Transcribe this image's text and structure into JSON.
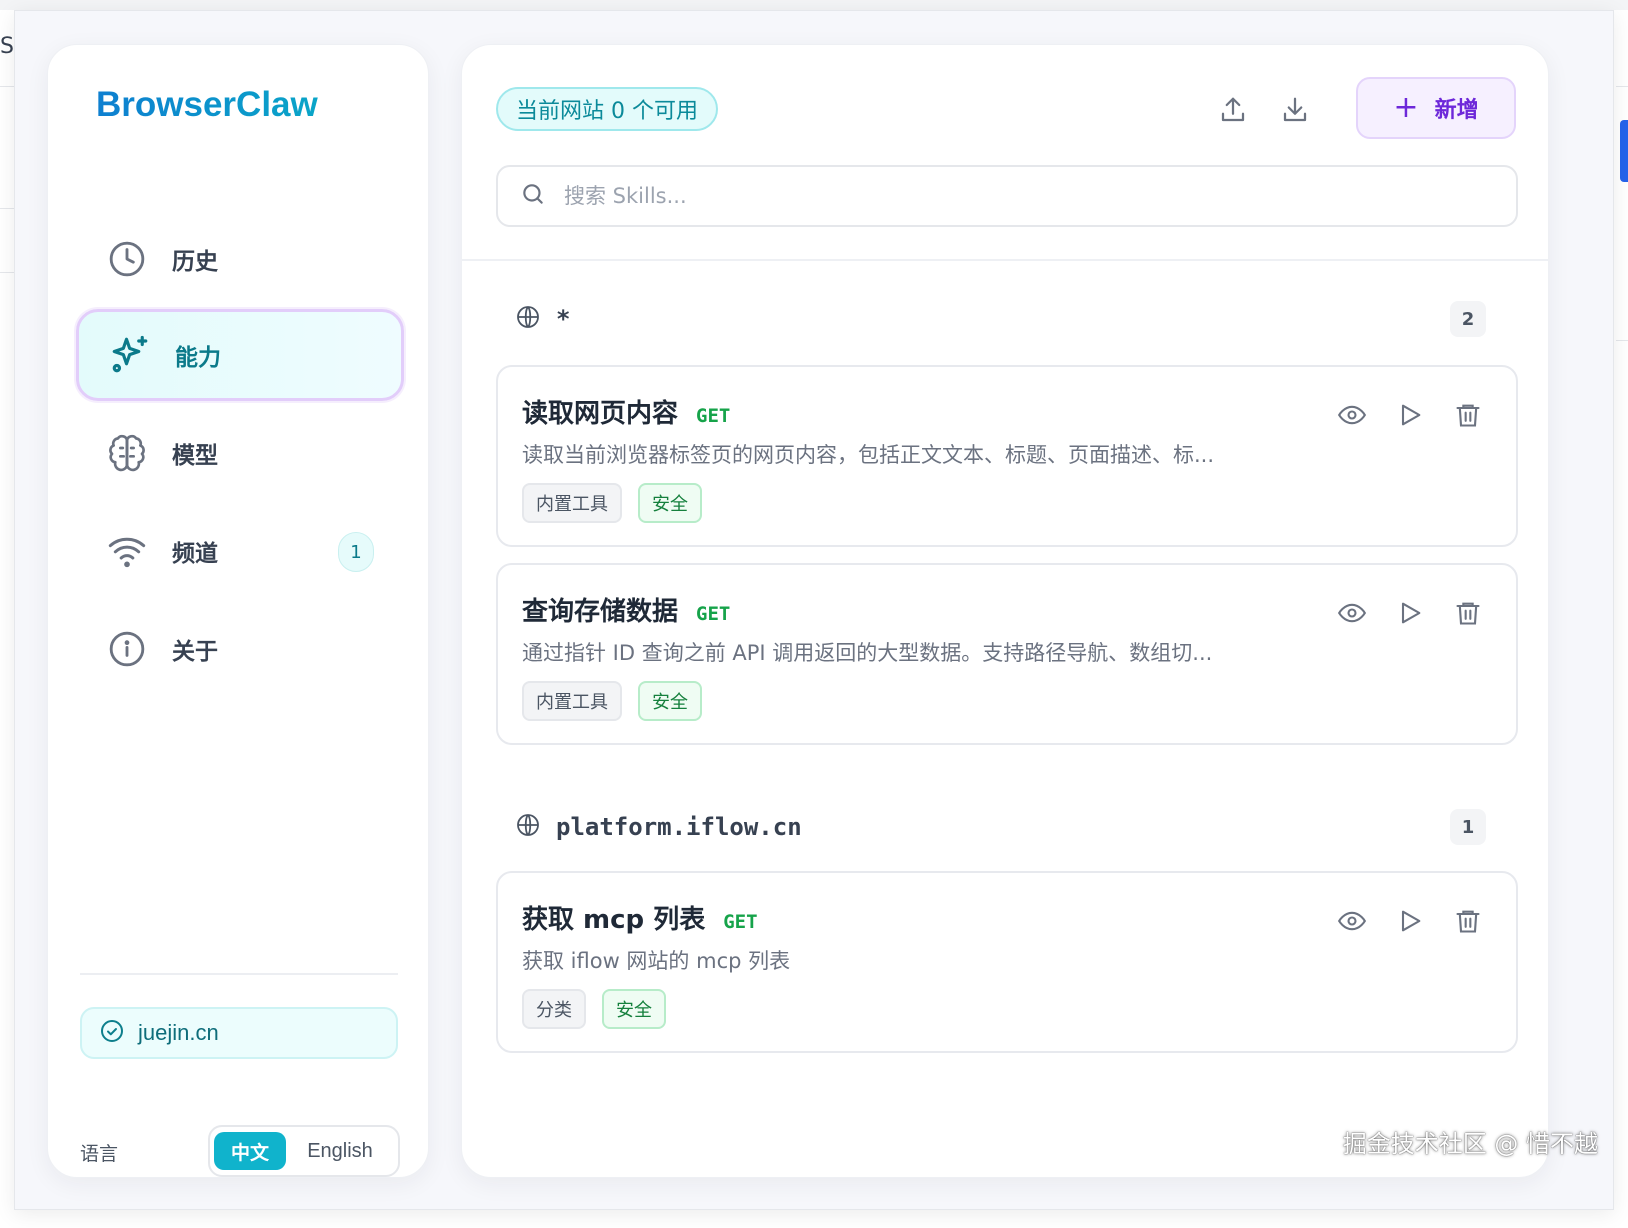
{
  "background": {
    "left_char": "S"
  },
  "sidebar": {
    "brand": "BrowserClaw",
    "items": [
      {
        "label": "历史",
        "icon": "clock-icon"
      },
      {
        "label": "能力",
        "icon": "sparkles-icon",
        "active": true
      },
      {
        "label": "模型",
        "icon": "brain-icon"
      },
      {
        "label": "频道",
        "icon": "wifi-icon",
        "badge": "1"
      },
      {
        "label": "关于",
        "icon": "info-icon"
      }
    ],
    "current_site": "juejin.cn",
    "language": {
      "label": "语言",
      "options": [
        "中文",
        "English"
      ],
      "selected": "中文"
    }
  },
  "main": {
    "available_pill": "当前网站 0 个可用",
    "add_button": {
      "plus": "+",
      "label": "新增"
    },
    "search": {
      "placeholder": "搜索 Skills..."
    },
    "groups": [
      {
        "name": "*",
        "count": "2",
        "cards": [
          {
            "title": "读取网页内容",
            "method": "GET",
            "description": "读取当前浏览器标签页的网页内容，包括正文文本、标题、页面描述、标...",
            "tags": [
              "内置工具",
              "安全"
            ]
          },
          {
            "title": "查询存储数据",
            "method": "GET",
            "description": "通过指针 ID 查询之前 API 调用返回的大型数据。支持路径导航、数组切...",
            "tags": [
              "内置工具",
              "安全"
            ]
          }
        ]
      },
      {
        "name": "platform.iflow.cn",
        "count": "1",
        "cards": [
          {
            "title": "获取 mcp 列表",
            "method": "GET",
            "description": "获取 iflow 网站的 mcp 列表",
            "tags": [
              "分类",
              "安全"
            ]
          }
        ]
      }
    ]
  },
  "watermark": "掘金技术社区 @ 惜不越",
  "colors": {
    "brand": "#0e7fd0",
    "accent_teal": "#10b3cc",
    "method_green": "#16a34a",
    "add_purple": "#6d28d9"
  }
}
